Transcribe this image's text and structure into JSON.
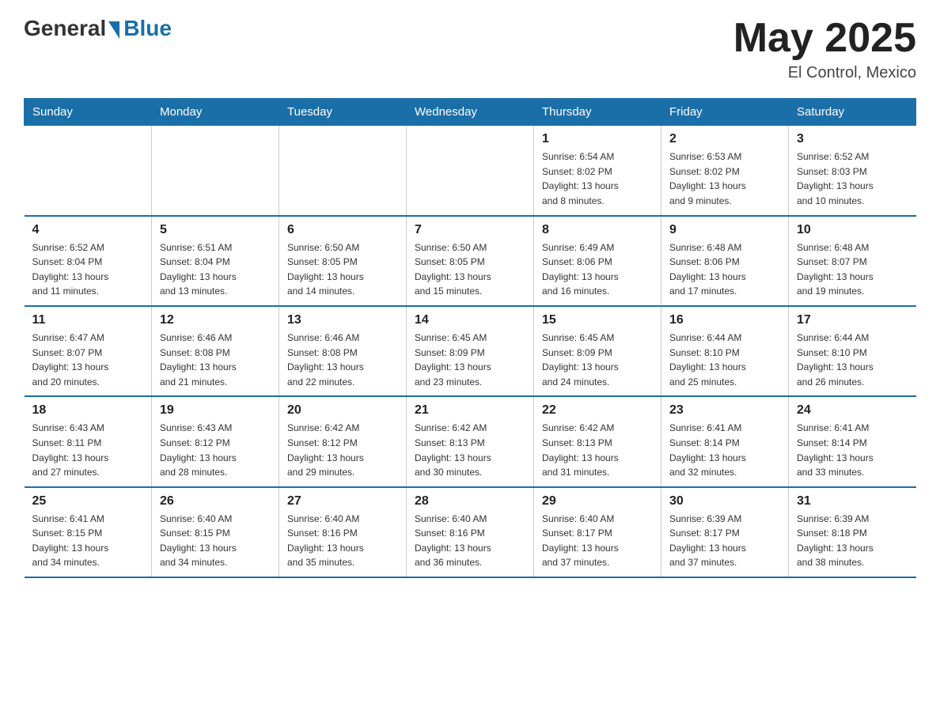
{
  "logo": {
    "general_text": "General",
    "blue_text": "Blue",
    "subtitle": "Blue"
  },
  "header": {
    "month": "May 2025",
    "location": "El Control, Mexico"
  },
  "weekdays": [
    "Sunday",
    "Monday",
    "Tuesday",
    "Wednesday",
    "Thursday",
    "Friday",
    "Saturday"
  ],
  "weeks": [
    [
      {
        "day": "",
        "info": ""
      },
      {
        "day": "",
        "info": ""
      },
      {
        "day": "",
        "info": ""
      },
      {
        "day": "",
        "info": ""
      },
      {
        "day": "1",
        "info": "Sunrise: 6:54 AM\nSunset: 8:02 PM\nDaylight: 13 hours\nand 8 minutes."
      },
      {
        "day": "2",
        "info": "Sunrise: 6:53 AM\nSunset: 8:02 PM\nDaylight: 13 hours\nand 9 minutes."
      },
      {
        "day": "3",
        "info": "Sunrise: 6:52 AM\nSunset: 8:03 PM\nDaylight: 13 hours\nand 10 minutes."
      }
    ],
    [
      {
        "day": "4",
        "info": "Sunrise: 6:52 AM\nSunset: 8:04 PM\nDaylight: 13 hours\nand 11 minutes."
      },
      {
        "day": "5",
        "info": "Sunrise: 6:51 AM\nSunset: 8:04 PM\nDaylight: 13 hours\nand 13 minutes."
      },
      {
        "day": "6",
        "info": "Sunrise: 6:50 AM\nSunset: 8:05 PM\nDaylight: 13 hours\nand 14 minutes."
      },
      {
        "day": "7",
        "info": "Sunrise: 6:50 AM\nSunset: 8:05 PM\nDaylight: 13 hours\nand 15 minutes."
      },
      {
        "day": "8",
        "info": "Sunrise: 6:49 AM\nSunset: 8:06 PM\nDaylight: 13 hours\nand 16 minutes."
      },
      {
        "day": "9",
        "info": "Sunrise: 6:48 AM\nSunset: 8:06 PM\nDaylight: 13 hours\nand 17 minutes."
      },
      {
        "day": "10",
        "info": "Sunrise: 6:48 AM\nSunset: 8:07 PM\nDaylight: 13 hours\nand 19 minutes."
      }
    ],
    [
      {
        "day": "11",
        "info": "Sunrise: 6:47 AM\nSunset: 8:07 PM\nDaylight: 13 hours\nand 20 minutes."
      },
      {
        "day": "12",
        "info": "Sunrise: 6:46 AM\nSunset: 8:08 PM\nDaylight: 13 hours\nand 21 minutes."
      },
      {
        "day": "13",
        "info": "Sunrise: 6:46 AM\nSunset: 8:08 PM\nDaylight: 13 hours\nand 22 minutes."
      },
      {
        "day": "14",
        "info": "Sunrise: 6:45 AM\nSunset: 8:09 PM\nDaylight: 13 hours\nand 23 minutes."
      },
      {
        "day": "15",
        "info": "Sunrise: 6:45 AM\nSunset: 8:09 PM\nDaylight: 13 hours\nand 24 minutes."
      },
      {
        "day": "16",
        "info": "Sunrise: 6:44 AM\nSunset: 8:10 PM\nDaylight: 13 hours\nand 25 minutes."
      },
      {
        "day": "17",
        "info": "Sunrise: 6:44 AM\nSunset: 8:10 PM\nDaylight: 13 hours\nand 26 minutes."
      }
    ],
    [
      {
        "day": "18",
        "info": "Sunrise: 6:43 AM\nSunset: 8:11 PM\nDaylight: 13 hours\nand 27 minutes."
      },
      {
        "day": "19",
        "info": "Sunrise: 6:43 AM\nSunset: 8:12 PM\nDaylight: 13 hours\nand 28 minutes."
      },
      {
        "day": "20",
        "info": "Sunrise: 6:42 AM\nSunset: 8:12 PM\nDaylight: 13 hours\nand 29 minutes."
      },
      {
        "day": "21",
        "info": "Sunrise: 6:42 AM\nSunset: 8:13 PM\nDaylight: 13 hours\nand 30 minutes."
      },
      {
        "day": "22",
        "info": "Sunrise: 6:42 AM\nSunset: 8:13 PM\nDaylight: 13 hours\nand 31 minutes."
      },
      {
        "day": "23",
        "info": "Sunrise: 6:41 AM\nSunset: 8:14 PM\nDaylight: 13 hours\nand 32 minutes."
      },
      {
        "day": "24",
        "info": "Sunrise: 6:41 AM\nSunset: 8:14 PM\nDaylight: 13 hours\nand 33 minutes."
      }
    ],
    [
      {
        "day": "25",
        "info": "Sunrise: 6:41 AM\nSunset: 8:15 PM\nDaylight: 13 hours\nand 34 minutes."
      },
      {
        "day": "26",
        "info": "Sunrise: 6:40 AM\nSunset: 8:15 PM\nDaylight: 13 hours\nand 34 minutes."
      },
      {
        "day": "27",
        "info": "Sunrise: 6:40 AM\nSunset: 8:16 PM\nDaylight: 13 hours\nand 35 minutes."
      },
      {
        "day": "28",
        "info": "Sunrise: 6:40 AM\nSunset: 8:16 PM\nDaylight: 13 hours\nand 36 minutes."
      },
      {
        "day": "29",
        "info": "Sunrise: 6:40 AM\nSunset: 8:17 PM\nDaylight: 13 hours\nand 37 minutes."
      },
      {
        "day": "30",
        "info": "Sunrise: 6:39 AM\nSunset: 8:17 PM\nDaylight: 13 hours\nand 37 minutes."
      },
      {
        "day": "31",
        "info": "Sunrise: 6:39 AM\nSunset: 8:18 PM\nDaylight: 13 hours\nand 38 minutes."
      }
    ]
  ]
}
